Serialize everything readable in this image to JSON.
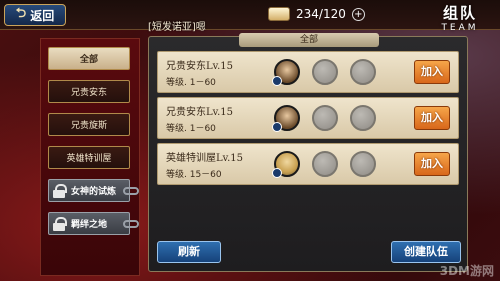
{
  "header": {
    "back_label": "返回",
    "back_icon": "back-arrow-icon",
    "stamina_text": "234/120",
    "plus_symbol": "+",
    "title_cn": "组队",
    "title_en": "TEAM",
    "chat_line": "[短发诺亚]嗯"
  },
  "sidebar": {
    "items": [
      {
        "label": "全部"
      },
      {
        "label": "兄贵安东"
      },
      {
        "label": "兄贵旋斯"
      },
      {
        "label": "英雄特训屋"
      },
      {
        "label": "女神的试炼"
      },
      {
        "label": "羁绊之地"
      }
    ]
  },
  "panel": {
    "header_label": "全部",
    "rows": [
      {
        "title": "兄贵安东Lv.15",
        "level": "等级. 1－60",
        "join_label": "加入"
      },
      {
        "title": "兄贵安东Lv.15",
        "level": "等级. 1－60",
        "join_label": "加入"
      },
      {
        "title": "英雄特训屋Lv.15",
        "level": "等级. 15－60",
        "join_label": "加入"
      }
    ],
    "refresh_label": "刷新",
    "create_label": "创建队伍"
  },
  "watermark": "3DM游网"
}
